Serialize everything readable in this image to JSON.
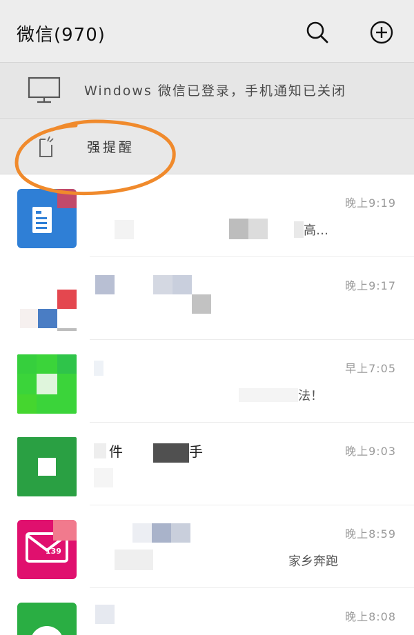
{
  "header": {
    "title": "微信(970)"
  },
  "banners": {
    "windows_login": "Windows 微信已登录，手机通知已关闭",
    "strong_remind": "强提醒"
  },
  "chats": [
    {
      "time": "晚上9:19",
      "preview_fragment": "高…"
    },
    {
      "time": "晚上9:17"
    },
    {
      "time": "早上7:05",
      "preview_fragment": "法！"
    },
    {
      "time": "晚上9:03",
      "name_fragment_1": "件",
      "name_fragment_2": "手"
    },
    {
      "time": "晚上8:59",
      "preview_fragment": "家乡奔跑",
      "avatar_badge": "139"
    },
    {
      "time": "晚上8:08"
    }
  ],
  "colors": {
    "header_bg": "#ededed",
    "banner_bg": "#e6e6e6",
    "annotation_orange": "#f08a2c",
    "wechat_green": "#2aae43",
    "mail_pink": "#e0106e",
    "doc_blue": "#2f7fd6"
  },
  "icons": {
    "search": "search-icon",
    "add": "plus-circle-icon",
    "monitor": "monitor-icon",
    "phone_alert": "phone-alert-icon"
  }
}
